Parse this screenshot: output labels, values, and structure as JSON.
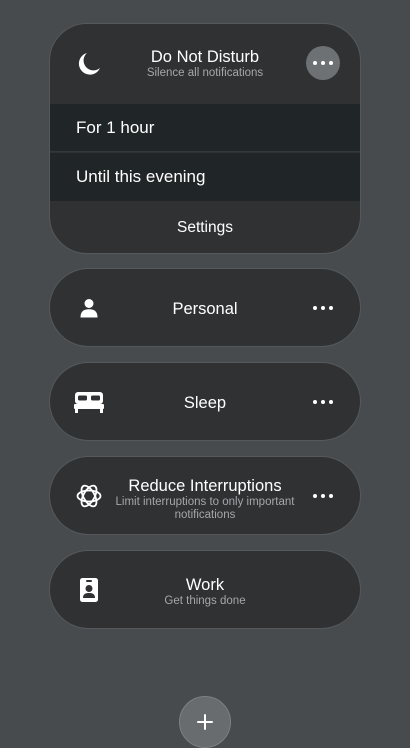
{
  "do_not_disturb": {
    "title": "Do Not Disturb",
    "subtitle": "Silence all notifications",
    "icon": "moon-icon",
    "options": [
      {
        "label": "For 1 hour"
      },
      {
        "label": "Until this evening"
      }
    ],
    "settings_label": "Settings"
  },
  "focus_modes": [
    {
      "title": "Personal",
      "subtitle": "",
      "icon": "person-icon"
    },
    {
      "title": "Sleep",
      "subtitle": "",
      "icon": "bed-icon"
    },
    {
      "title": "Reduce Interruptions",
      "subtitle": "Limit interruptions to only important notifications",
      "icon": "flower-icon"
    },
    {
      "title": "Work",
      "subtitle": "Get things done",
      "icon": "id-badge-icon"
    }
  ],
  "colors": {
    "background": "#474b4d",
    "card": "#2f3133",
    "option_row": "#202527",
    "secondary_text": "#a4a8ab"
  }
}
